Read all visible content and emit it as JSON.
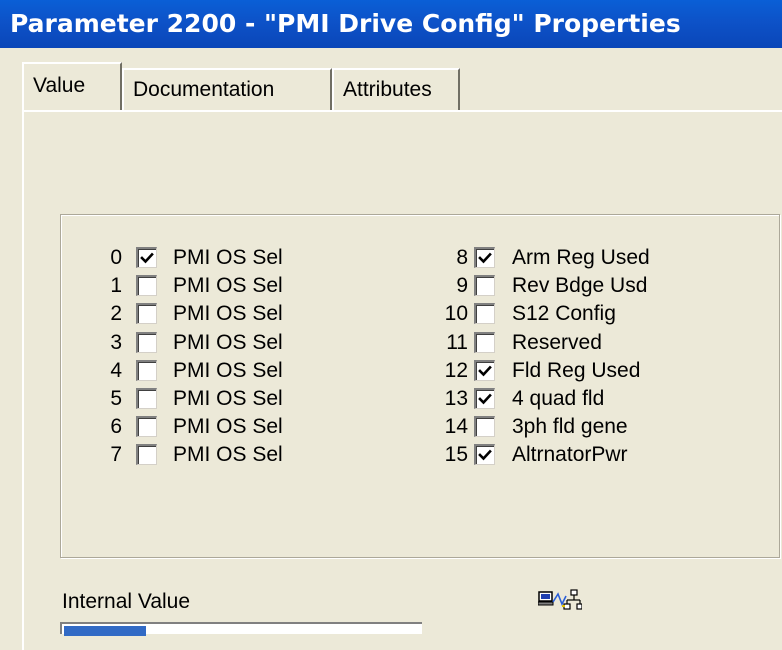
{
  "window": {
    "title": "Parameter 2200 - \"PMI Drive Config\" Properties"
  },
  "tabs": [
    {
      "label": "Value",
      "active": true
    },
    {
      "label": "Documentation",
      "active": false
    },
    {
      "label": "Attributes",
      "active": false
    }
  ],
  "bits_left": [
    {
      "num": "0",
      "label": "PMI OS Sel",
      "checked": true
    },
    {
      "num": "1",
      "label": "PMI OS Sel",
      "checked": false
    },
    {
      "num": "2",
      "label": "PMI OS Sel",
      "checked": false
    },
    {
      "num": "3",
      "label": "PMI OS Sel",
      "checked": false
    },
    {
      "num": "4",
      "label": "PMI OS Sel",
      "checked": false
    },
    {
      "num": "5",
      "label": "PMI OS Sel",
      "checked": false
    },
    {
      "num": "6",
      "label": "PMI OS Sel",
      "checked": false
    },
    {
      "num": "7",
      "label": "PMI OS Sel",
      "checked": false
    }
  ],
  "bits_right": [
    {
      "num": "8",
      "label": "Arm Reg Used",
      "checked": true
    },
    {
      "num": "9",
      "label": "Rev Bdge Usd",
      "checked": false
    },
    {
      "num": "10",
      "label": "S12 Config",
      "checked": false
    },
    {
      "num": "11",
      "label": "Reserved",
      "checked": false
    },
    {
      "num": "12",
      "label": "Fld Reg Used",
      "checked": true
    },
    {
      "num": "13",
      "label": "4 quad fld",
      "checked": true
    },
    {
      "num": "14",
      "label": "3ph fld gene",
      "checked": false
    },
    {
      "num": "15",
      "label": "AltrnatorPwr",
      "checked": true
    }
  ],
  "internal_value": {
    "label": "Internal Value"
  },
  "icons": {
    "network": "network-computer-icon"
  },
  "colors": {
    "titlebar": "#0a52c8",
    "dialog_bg": "#ece9d8",
    "selection": "#316ac5"
  }
}
